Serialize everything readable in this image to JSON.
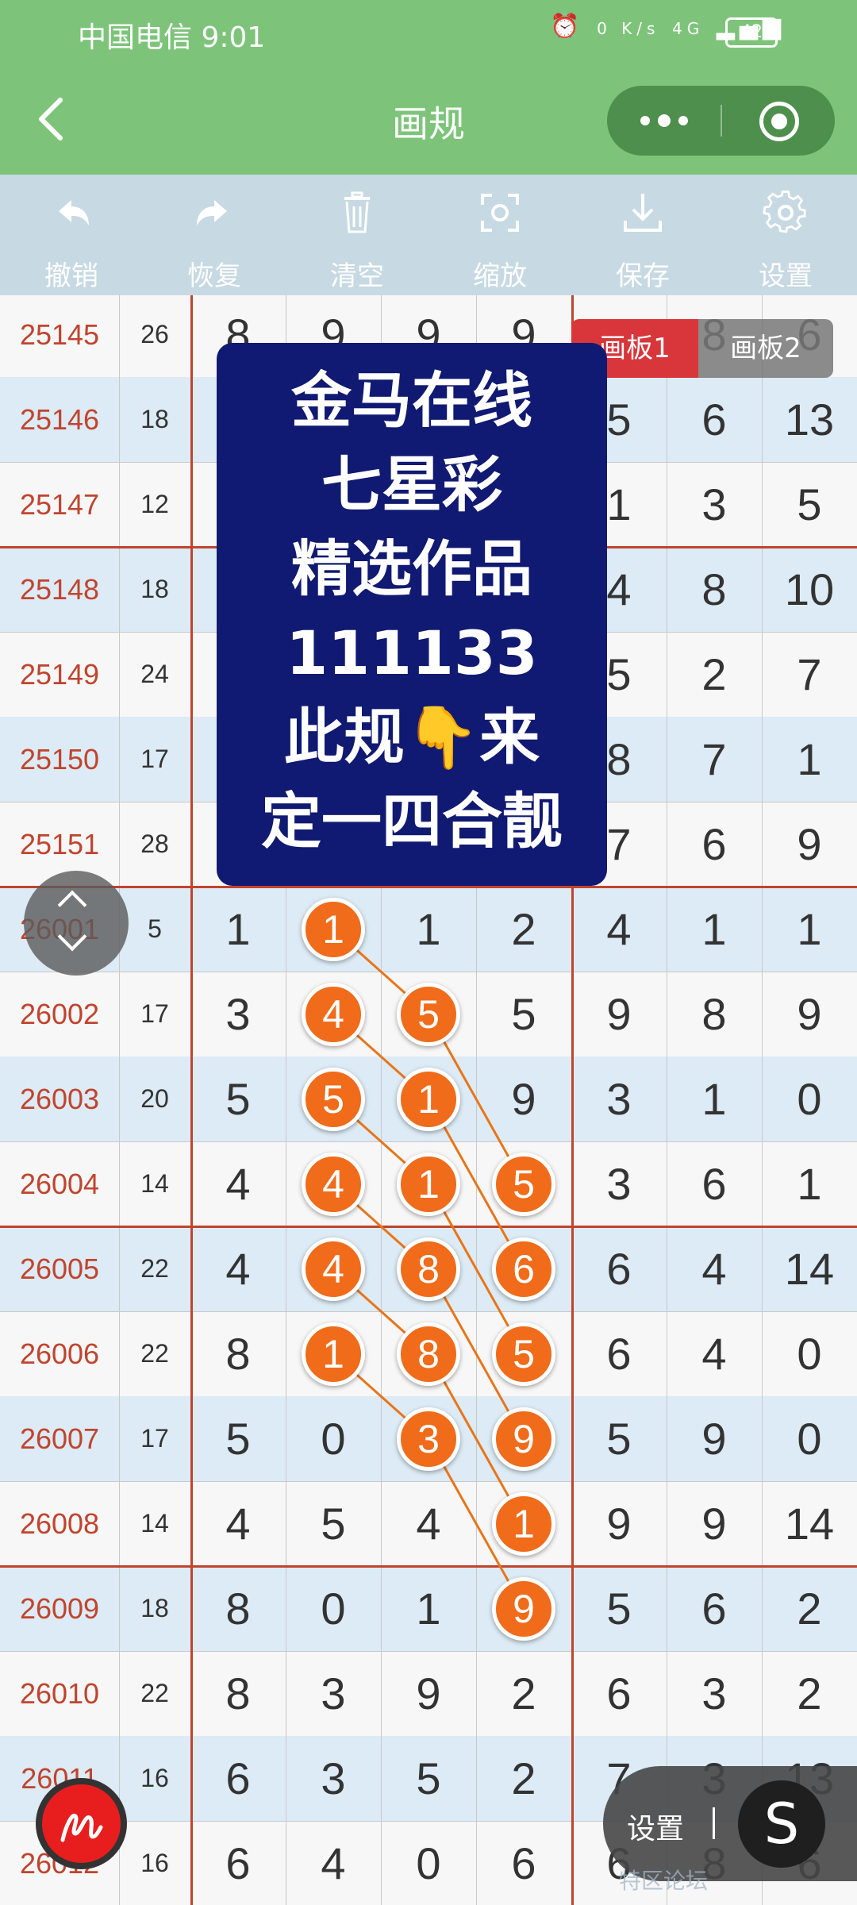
{
  "status_bar": {
    "carrier_time": "中国电信 9:01",
    "net_speed": "0 K/s",
    "network": "4G",
    "battery": "42"
  },
  "title_bar": {
    "back_icon": "chevron-left-icon",
    "title": "画规",
    "more_icon": "more-dots-icon",
    "target_icon": "target-icon"
  },
  "toolbar": [
    {
      "label": "撤销",
      "icon": "undo-icon"
    },
    {
      "label": "恢复",
      "icon": "redo-icon"
    },
    {
      "label": "清空",
      "icon": "trash-icon"
    },
    {
      "label": "缩放",
      "icon": "zoom-icon"
    },
    {
      "label": "保存",
      "icon": "download-icon"
    },
    {
      "label": "设置",
      "icon": "gear-icon"
    }
  ],
  "boards": {
    "board1": "画板1",
    "board2": "画板2"
  },
  "overlay_lines": [
    "金马在线",
    "七星彩",
    "精选作品",
    "111133",
    "此规👇来",
    "定一四合靓"
  ],
  "table": {
    "rows": [
      {
        "period": "25145",
        "sum": "26",
        "digits": [
          "8",
          "9",
          "9",
          "9",
          "6",
          "8",
          "6"
        ]
      },
      {
        "period": "25146",
        "sum": "18",
        "digits": [
          "",
          "",
          "",
          "",
          "5",
          "6",
          "13"
        ]
      },
      {
        "period": "25147",
        "sum": "12",
        "digits": [
          "",
          "",
          "",
          "",
          "1",
          "3",
          "5"
        ]
      },
      {
        "period": "25148",
        "sum": "18",
        "digits": [
          "",
          "",
          "",
          "",
          "4",
          "8",
          "10"
        ]
      },
      {
        "period": "25149",
        "sum": "24",
        "digits": [
          "",
          "",
          "",
          "",
          "5",
          "2",
          "7"
        ]
      },
      {
        "period": "25150",
        "sum": "17",
        "digits": [
          "",
          "",
          "",
          "",
          "8",
          "7",
          "1"
        ]
      },
      {
        "period": "25151",
        "sum": "28",
        "digits": [
          "",
          "",
          "",
          "",
          "7",
          "6",
          "9"
        ]
      },
      {
        "period": "26001",
        "sum": "5",
        "digits": [
          "1",
          "1",
          "1",
          "2",
          "4",
          "1",
          "1"
        ]
      },
      {
        "period": "26002",
        "sum": "17",
        "digits": [
          "3",
          "4",
          "5",
          "5",
          "9",
          "8",
          "9"
        ]
      },
      {
        "period": "26003",
        "sum": "20",
        "digits": [
          "5",
          "5",
          "1",
          "9",
          "3",
          "1",
          "0"
        ]
      },
      {
        "period": "26004",
        "sum": "14",
        "digits": [
          "4",
          "4",
          "1",
          "5",
          "3",
          "6",
          "1"
        ]
      },
      {
        "period": "26005",
        "sum": "22",
        "digits": [
          "4",
          "4",
          "8",
          "6",
          "6",
          "4",
          "14"
        ]
      },
      {
        "period": "26006",
        "sum": "22",
        "digits": [
          "8",
          "1",
          "8",
          "5",
          "6",
          "4",
          "0"
        ]
      },
      {
        "period": "26007",
        "sum": "17",
        "digits": [
          "5",
          "0",
          "3",
          "9",
          "5",
          "9",
          "0"
        ]
      },
      {
        "period": "26008",
        "sum": "14",
        "digits": [
          "4",
          "5",
          "4",
          "1",
          "9",
          "9",
          "14"
        ]
      },
      {
        "period": "26009",
        "sum": "18",
        "digits": [
          "8",
          "0",
          "1",
          "9",
          "5",
          "6",
          "2"
        ]
      },
      {
        "period": "26010",
        "sum": "22",
        "digits": [
          "8",
          "3",
          "9",
          "2",
          "6",
          "3",
          "2"
        ]
      },
      {
        "period": "26011",
        "sum": "16",
        "digits": [
          "6",
          "3",
          "5",
          "2",
          "7",
          "3",
          "13"
        ]
      },
      {
        "period": "26012",
        "sum": "16",
        "digits": [
          "6",
          "4",
          "0",
          "6",
          "6",
          "8",
          "6"
        ]
      }
    ],
    "highlights": [
      {
        "row": 7,
        "col": 1,
        "value": "1"
      },
      {
        "row": 8,
        "col": 1,
        "value": "4"
      },
      {
        "row": 8,
        "col": 2,
        "value": "5"
      },
      {
        "row": 9,
        "col": 1,
        "value": "5"
      },
      {
        "row": 9,
        "col": 2,
        "value": "1"
      },
      {
        "row": 10,
        "col": 1,
        "value": "4"
      },
      {
        "row": 10,
        "col": 2,
        "value": "1"
      },
      {
        "row": 10,
        "col": 3,
        "value": "5"
      },
      {
        "row": 11,
        "col": 1,
        "value": "4"
      },
      {
        "row": 11,
        "col": 2,
        "value": "8"
      },
      {
        "row": 11,
        "col": 3,
        "value": "6"
      },
      {
        "row": 12,
        "col": 1,
        "value": "1"
      },
      {
        "row": 12,
        "col": 2,
        "value": "8"
      },
      {
        "row": 12,
        "col": 3,
        "value": "5"
      },
      {
        "row": 13,
        "col": 2,
        "value": "3"
      },
      {
        "row": 13,
        "col": 3,
        "value": "9"
      },
      {
        "row": 14,
        "col": 3,
        "value": "1"
      },
      {
        "row": 15,
        "col": 3,
        "value": "9"
      }
    ],
    "connections": [
      [
        7,
        1,
        8,
        2
      ],
      [
        8,
        2,
        10,
        3
      ],
      [
        8,
        1,
        9,
        2
      ],
      [
        9,
        2,
        11,
        3
      ],
      [
        9,
        1,
        10,
        2
      ],
      [
        10,
        2,
        12,
        3
      ],
      [
        10,
        1,
        11,
        2
      ],
      [
        11,
        2,
        13,
        3
      ],
      [
        11,
        1,
        12,
        2
      ],
      [
        12,
        2,
        14,
        3
      ],
      [
        12,
        1,
        13,
        2
      ],
      [
        13,
        2,
        15,
        3
      ]
    ]
  },
  "floating": {
    "settings_label": "设置",
    "s_label": "S",
    "watermark": "特区论坛"
  }
}
